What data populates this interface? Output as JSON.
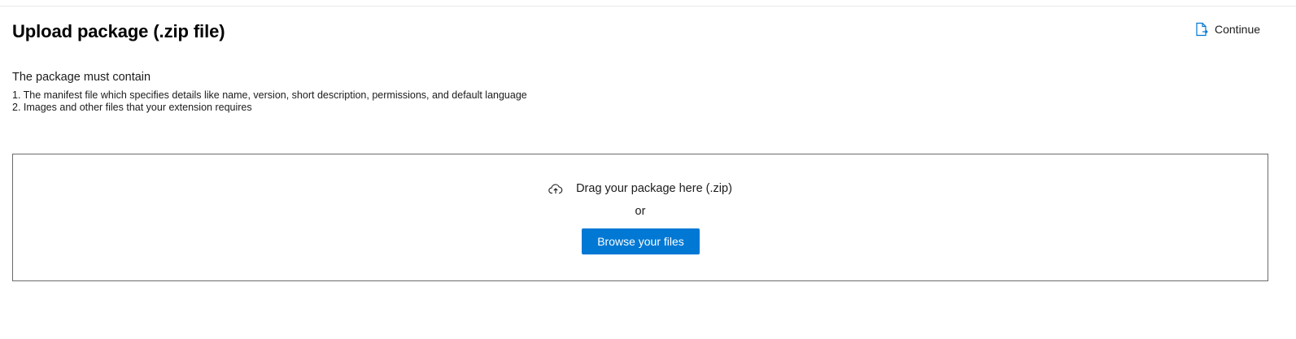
{
  "header": {
    "title": "Upload package (.zip file)",
    "continue_label": "Continue",
    "continue_icon": "document-arrow-icon"
  },
  "requirements": {
    "heading": "The package must contain",
    "items": [
      "1. The manifest file which specifies details like name, version, short description, permissions, and default language",
      "2. Images and other files that your extension requires"
    ]
  },
  "drop_zone": {
    "icon": "cloud-upload-icon",
    "drag_text": "Drag your package here (.zip)",
    "or_text": "or",
    "browse_label": "Browse your files"
  },
  "colors": {
    "accent": "#0078d4",
    "border": "#6b6b6b",
    "text": "#1b1b1b"
  }
}
